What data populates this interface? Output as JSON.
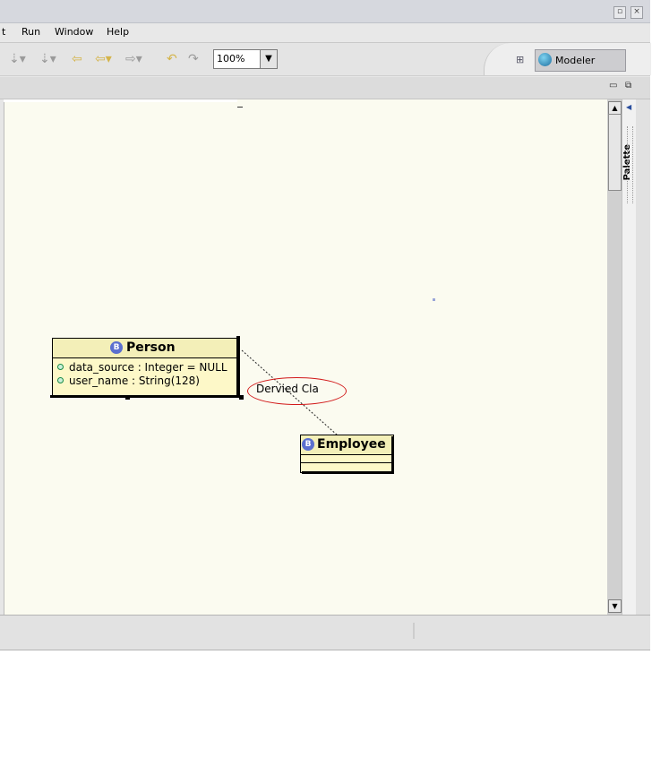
{
  "menu": {
    "partial_left": "t",
    "items": [
      {
        "label": "Run"
      },
      {
        "label": "Window"
      },
      {
        "label": "Help"
      }
    ]
  },
  "toolbar": {
    "zoom_value": "100%"
  },
  "perspective": {
    "label": "Modeler"
  },
  "palette": {
    "label": "Palette"
  },
  "diagram": {
    "person": {
      "name": "Person",
      "stereotype": "B",
      "attributes": [
        "data_source : Integer = NULL",
        "user_name : String(128)"
      ]
    },
    "employee": {
      "name": "Employee",
      "stereotype": "B"
    },
    "connection_label": "Dervied Cla"
  },
  "colors": {
    "canvas_bg": "#fbfbf0",
    "class_fill": "#fdf8c8",
    "annotation_red": "#d21a1a",
    "stereotype_icon": "#5b6fcf"
  }
}
